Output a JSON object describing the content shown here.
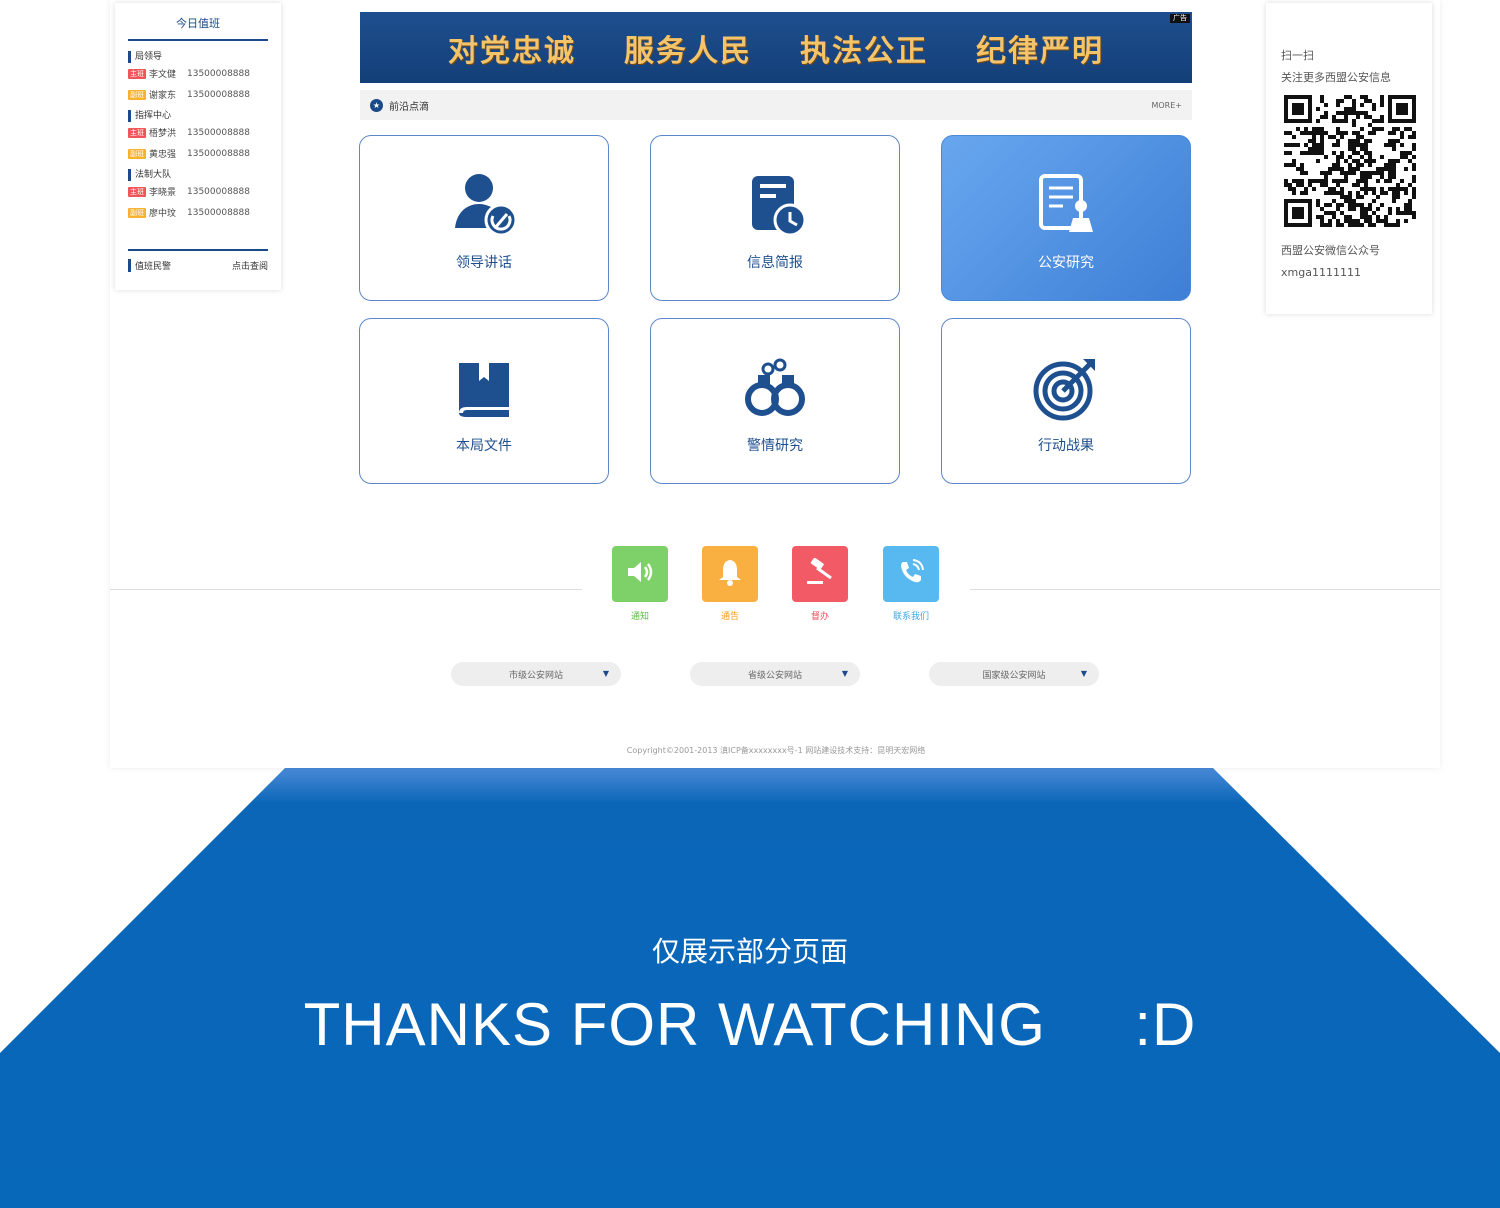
{
  "duty": {
    "title": "今日值班",
    "sections": [
      {
        "name": "局领导",
        "rows": [
          {
            "tag": "主班",
            "name": "李文健",
            "phone": "13500008888"
          },
          {
            "tag": "副班",
            "name": "谢家东",
            "phone": "13500008888"
          }
        ]
      },
      {
        "name": "指挥中心",
        "rows": [
          {
            "tag": "主班",
            "name": "梧梦洪",
            "phone": "13500008888"
          },
          {
            "tag": "副班",
            "name": "黄忠强",
            "phone": "13500008888"
          }
        ]
      },
      {
        "name": "法制大队",
        "rows": [
          {
            "tag": "主班",
            "name": "李晓景",
            "phone": "13500008888"
          },
          {
            "tag": "副班",
            "name": "廖中玟",
            "phone": "13500008888"
          }
        ]
      }
    ],
    "footer_label": "值班民警",
    "footer_link": "点击查阅"
  },
  "banner": {
    "slogans": [
      "对党忠诚",
      "服务人民",
      "执法公正",
      "纪律严明"
    ],
    "ad": "广告"
  },
  "section": {
    "title": "前沿点滴",
    "more": "MORE+"
  },
  "tiles": [
    {
      "label": "领导讲话",
      "icon": "leader-speech-icon"
    },
    {
      "label": "信息简报",
      "icon": "info-brief-icon"
    },
    {
      "label": "公安研究",
      "icon": "police-research-icon"
    },
    {
      "label": "本局文件",
      "icon": "bureau-files-icon"
    },
    {
      "label": "警情研究",
      "icon": "handcuffs-icon"
    },
    {
      "label": "行动战果",
      "icon": "target-icon"
    }
  ],
  "quick": [
    {
      "label": "通知",
      "icon": "speaker-icon",
      "color": "#7ed068"
    },
    {
      "label": "通告",
      "icon": "bell-icon",
      "color": "#f9b040"
    },
    {
      "label": "督办",
      "icon": "gavel-icon",
      "color": "#f25a66"
    },
    {
      "label": "联系我们",
      "icon": "phone-icon",
      "color": "#58b9f0"
    }
  ],
  "sites": [
    "市级公安网站",
    "省级公安网站",
    "国家级公安网站"
  ],
  "copyright": "Copyright©2001-2013 滇ICP备xxxxxxxx号-1  网站建设技术支持：昆明天宏网络",
  "qr": {
    "line1": "扫一扫",
    "line2": "关注更多西盟公安信息",
    "line3": "西盟公安微信公众号",
    "line4": "xmga1111111"
  },
  "bottom": {
    "note": "仅展示部分页面",
    "thanks": "THANKS FOR WATCHING     :D"
  }
}
